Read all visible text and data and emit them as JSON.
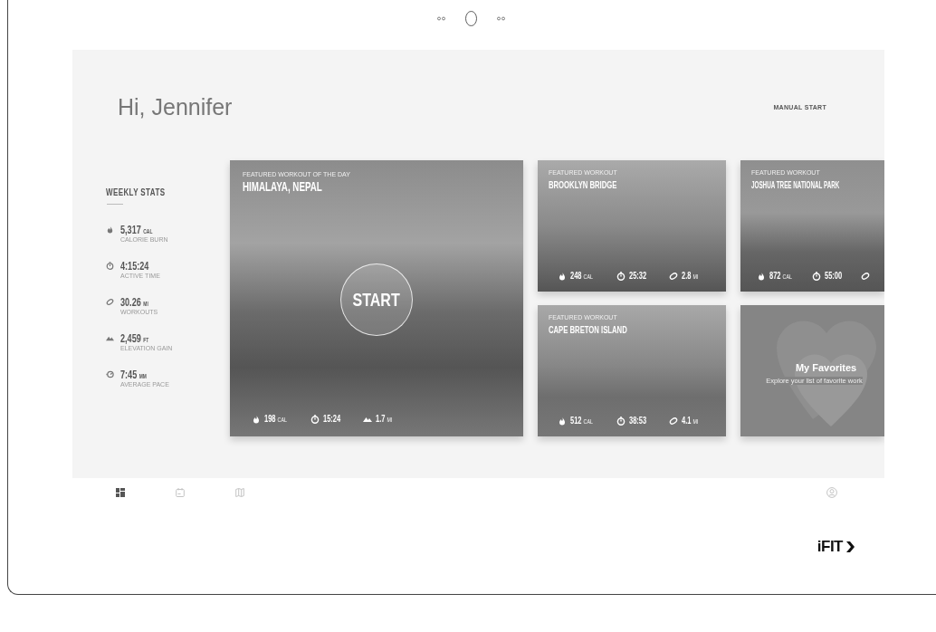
{
  "header": {
    "greeting": "Hi, Jennifer",
    "action": "MANUAL START"
  },
  "weekly_stats": {
    "title": "WEEKLY STATS",
    "items": [
      {
        "kind": "calories",
        "value": "5,317",
        "unit": "CAL",
        "label": "CALORIE BURN"
      },
      {
        "kind": "time",
        "value": "4:15:24",
        "label": "ACTIVE TIME"
      },
      {
        "kind": "distance",
        "value": "30.26",
        "unit": "MI",
        "label": "WORKOUTS"
      },
      {
        "kind": "elevation",
        "value": "2,459",
        "unit": "FT",
        "label": "ELEVATION GAIN"
      },
      {
        "kind": "pace",
        "value": "7:45",
        "unit": "MM",
        "label": "AVERAGE PACE"
      }
    ]
  },
  "featured": {
    "eyebrow": "FEATURED WORKOUT OF THE DAY",
    "title": "HIMALAYA, NEPAL",
    "start": "START",
    "stats": [
      {
        "kind": "calories",
        "value": "198",
        "unit": "CAL"
      },
      {
        "kind": "time",
        "value": "15:24"
      },
      {
        "kind": "elevation",
        "value": "1.7",
        "unit": "MI"
      }
    ]
  },
  "workouts": [
    {
      "eyebrow": "FEATURED WORKOUT",
      "title": "BROOKLYN BRIDGE",
      "stats": [
        {
          "kind": "calories",
          "value": "248",
          "unit": "CAL"
        },
        {
          "kind": "time",
          "value": "25:32"
        },
        {
          "kind": "distance",
          "value": "2.8",
          "unit": "MI"
        }
      ]
    },
    {
      "eyebrow": "FEATURED WORKOUT",
      "title": "JOSHUA TREE NATIONAL PARK",
      "stats": [
        {
          "kind": "calories",
          "value": "872",
          "unit": "CAL"
        },
        {
          "kind": "time",
          "value": "55:00"
        },
        {
          "kind": "distance"
        }
      ]
    },
    {
      "eyebrow": "FEATURED WORKOUT",
      "title": "CAPE BRETON ISLAND",
      "stats": [
        {
          "kind": "calories",
          "value": "512",
          "unit": "CAL"
        },
        {
          "kind": "time",
          "value": "38:53"
        },
        {
          "kind": "distance",
          "value": "4.1",
          "unit": "MI"
        }
      ]
    }
  ],
  "favorites": {
    "title": "My Favorites",
    "subtitle": "Explore your list of favorite work"
  },
  "nav": [
    {
      "kind": "dashboard",
      "selected": true
    },
    {
      "kind": "calendar",
      "selected": false
    },
    {
      "kind": "map",
      "selected": false
    },
    {
      "kind": "profile",
      "selected": false
    }
  ],
  "logo": "iFIT"
}
